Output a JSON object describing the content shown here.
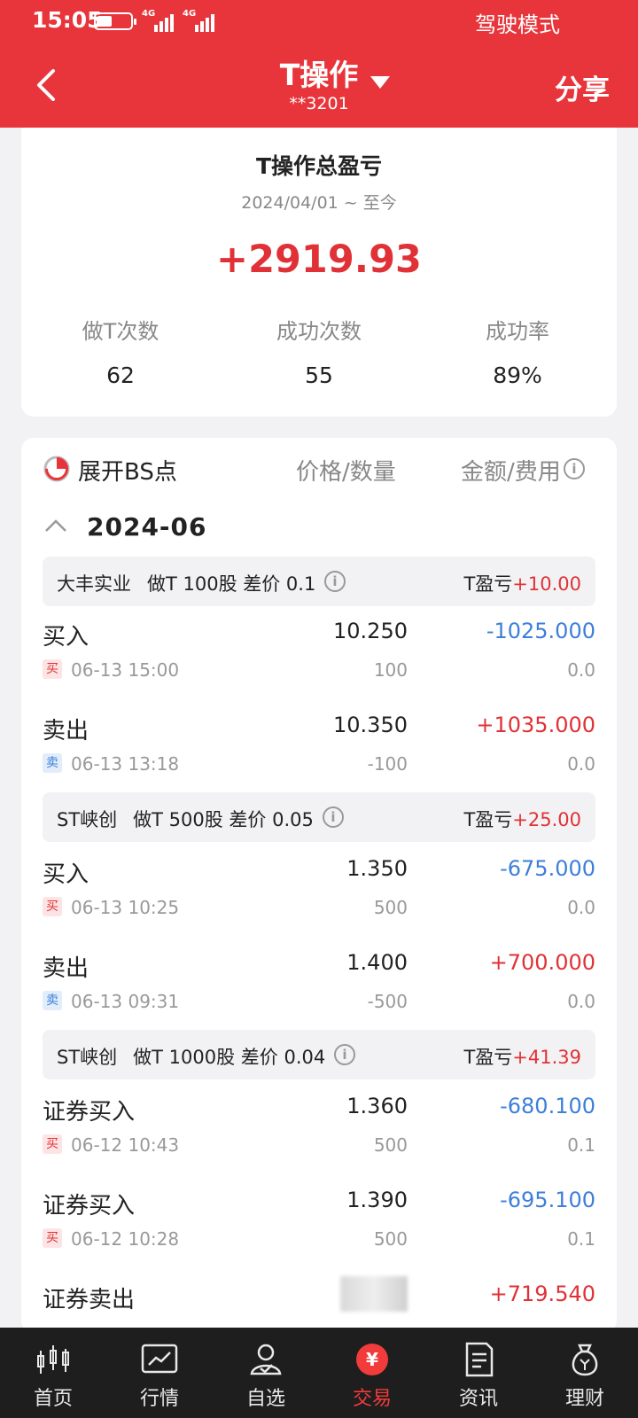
{
  "status_bar": {
    "time": "15:05",
    "net1": "4G",
    "net2": "4G",
    "mode": "驾驶模式"
  },
  "header": {
    "title": "T操作",
    "account": "**3201",
    "share": "分享"
  },
  "summary": {
    "title": "T操作总盈亏",
    "date_range": "2024/04/01 ~ 至今",
    "total": "+2919.93",
    "stats": [
      {
        "label": "做T次数",
        "value": "62"
      },
      {
        "label": "成功次数",
        "value": "55"
      },
      {
        "label": "成功率",
        "value": "89%"
      }
    ]
  },
  "list": {
    "bs_toggle": "展开BS点",
    "col_price": "价格/数量",
    "col_amount": "金额/费用",
    "info_glyph": "i",
    "month": "2024-06",
    "pl_prefix": "T盈亏",
    "groups": [
      {
        "name": "大丰实业",
        "detail": "做T 100股 差价 0.1",
        "pl": "+10.00"
      },
      {
        "name": "ST峡创",
        "detail": "做T 500股 差价 0.05",
        "pl": "+25.00"
      },
      {
        "name": "ST峡创",
        "detail": "做T 1000股 差价 0.04",
        "pl": "+41.39"
      }
    ],
    "trades": [
      {
        "type": "买入",
        "tag": "买",
        "time": "06-13 15:00",
        "price": "10.250",
        "qty": "100",
        "amount": "-1025.000",
        "fee": "0.0"
      },
      {
        "type": "卖出",
        "tag": "卖",
        "time": "06-13 13:18",
        "price": "10.350",
        "qty": "-100",
        "amount": "+1035.000",
        "fee": "0.0"
      },
      {
        "type": "买入",
        "tag": "买",
        "time": "06-13 10:25",
        "price": "1.350",
        "qty": "500",
        "amount": "-675.000",
        "fee": "0.0"
      },
      {
        "type": "卖出",
        "tag": "卖",
        "time": "06-13 09:31",
        "price": "1.400",
        "qty": "-500",
        "amount": "+700.000",
        "fee": "0.0"
      },
      {
        "type": "证券买入",
        "tag": "买",
        "time": "06-12 10:43",
        "price": "1.360",
        "qty": "500",
        "amount": "-680.100",
        "fee": "0.1"
      },
      {
        "type": "证券买入",
        "tag": "买",
        "time": "06-12 10:28",
        "price": "1.390",
        "qty": "500",
        "amount": "-695.100",
        "fee": "0.1"
      },
      {
        "type": "证券卖出",
        "amount": "+719.540"
      }
    ]
  },
  "tabbar": {
    "items": [
      {
        "label": "首页",
        "icon": "candlestick-icon"
      },
      {
        "label": "行情",
        "icon": "chart-icon"
      },
      {
        "label": "自选",
        "icon": "user-check-icon"
      },
      {
        "label": "交易",
        "icon": "yen-icon",
        "glyph": "¥"
      },
      {
        "label": "资讯",
        "icon": "document-icon"
      },
      {
        "label": "理财",
        "icon": "money-bag-icon"
      }
    ],
    "active_color": "#f23b3b"
  },
  "colors": {
    "brand": "#e8353b",
    "gain": "#e03236",
    "loss": "#3d7fd9"
  }
}
